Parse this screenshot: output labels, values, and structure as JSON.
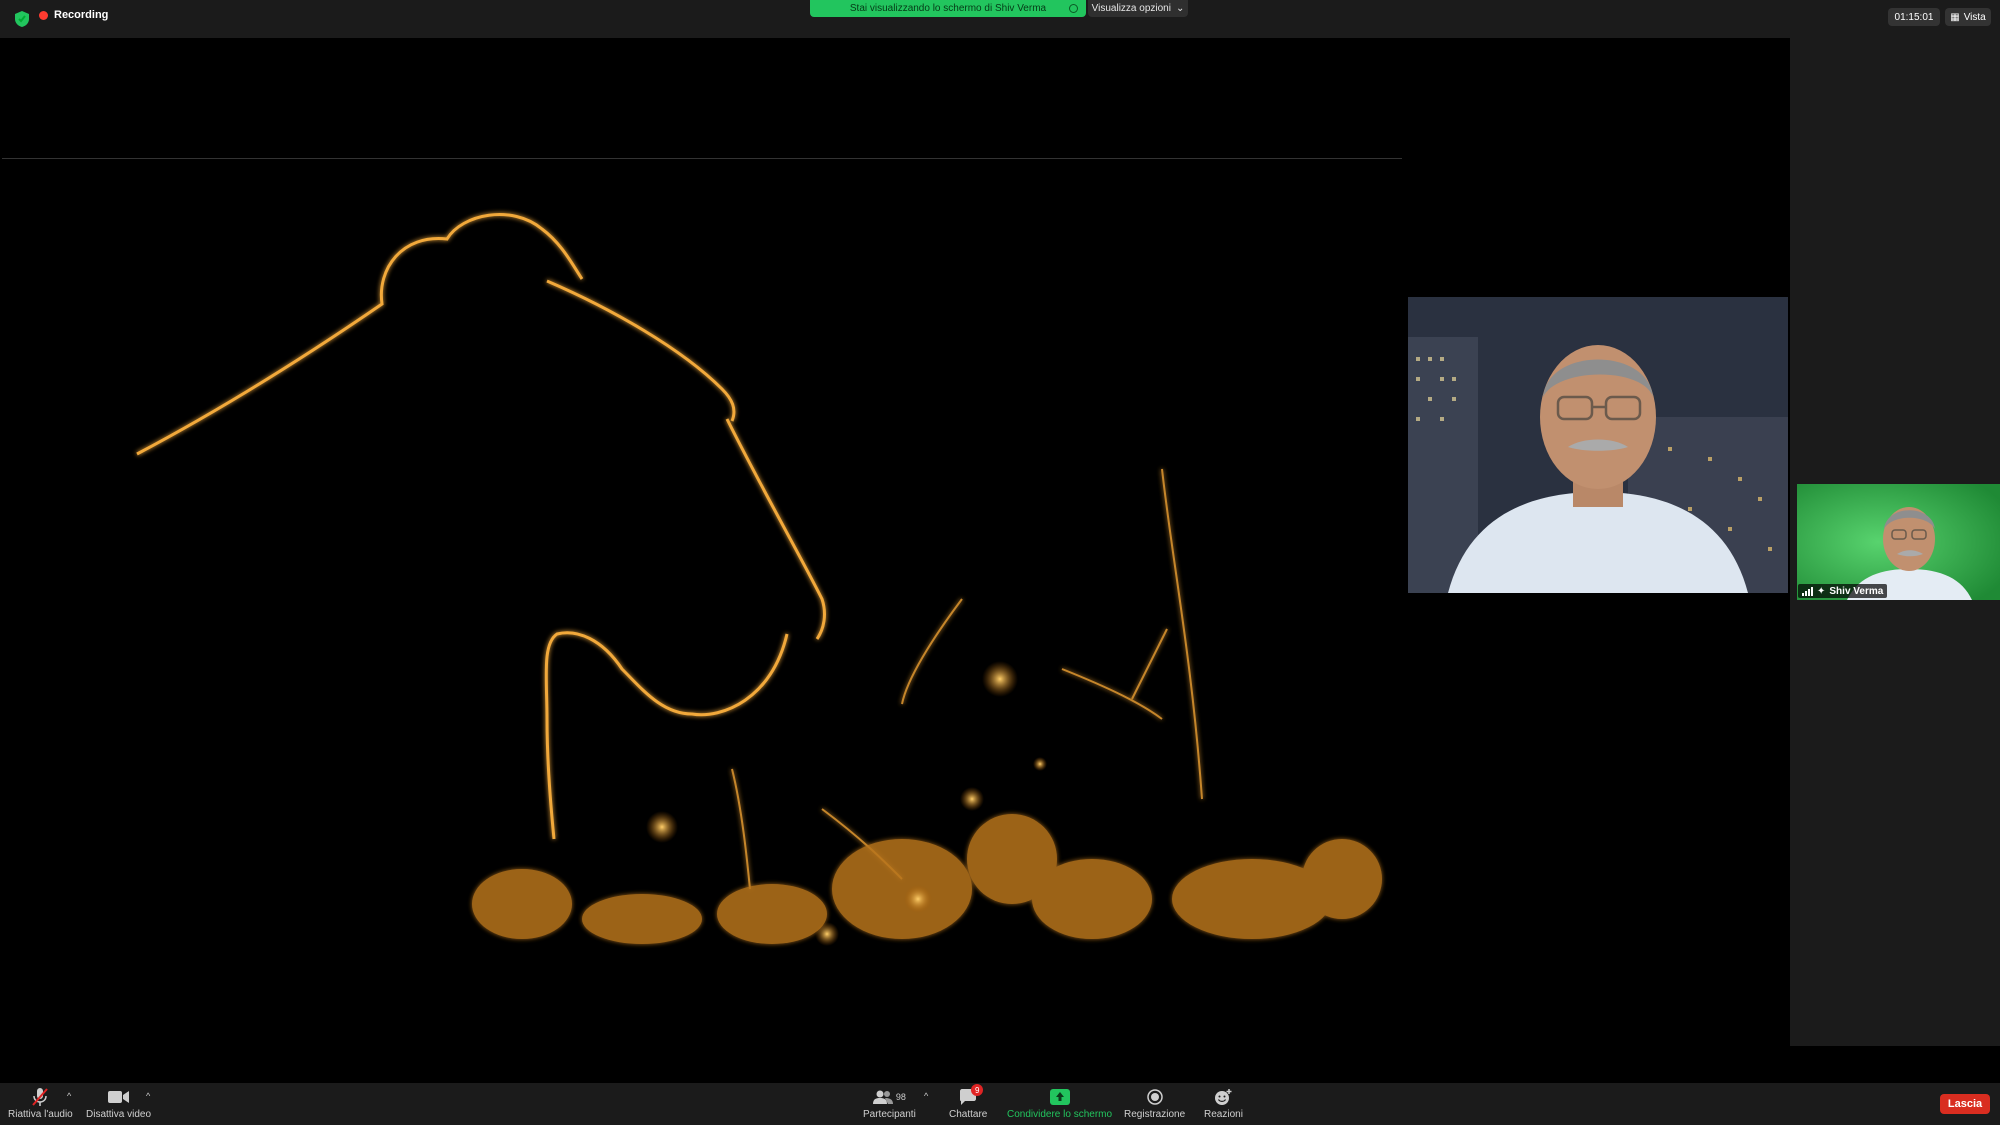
{
  "top": {
    "recording_label": "Recording",
    "share_banner": "Stai visualizzando lo schermo di Shiv Verma",
    "view_options_label": "Visualizza opzioni",
    "timer": "01:15:01",
    "view_label": "Vista"
  },
  "participants": {
    "thumbnail_name": "Shiv Verma"
  },
  "toolbar": {
    "audio_label": "Riattiva l'audio",
    "video_label": "Disattiva video",
    "participants_label": "Partecipanti",
    "participants_count": "98",
    "chat_label": "Chattare",
    "chat_badge": "9",
    "share_label": "Condividere lo schermo",
    "record_label": "Registrazione",
    "reactions_label": "Reazioni",
    "leave_label": "Lascia"
  },
  "colors": {
    "accent_green": "#22c55e",
    "recording_red": "#ff3b30",
    "leave_red": "#d92d20"
  }
}
